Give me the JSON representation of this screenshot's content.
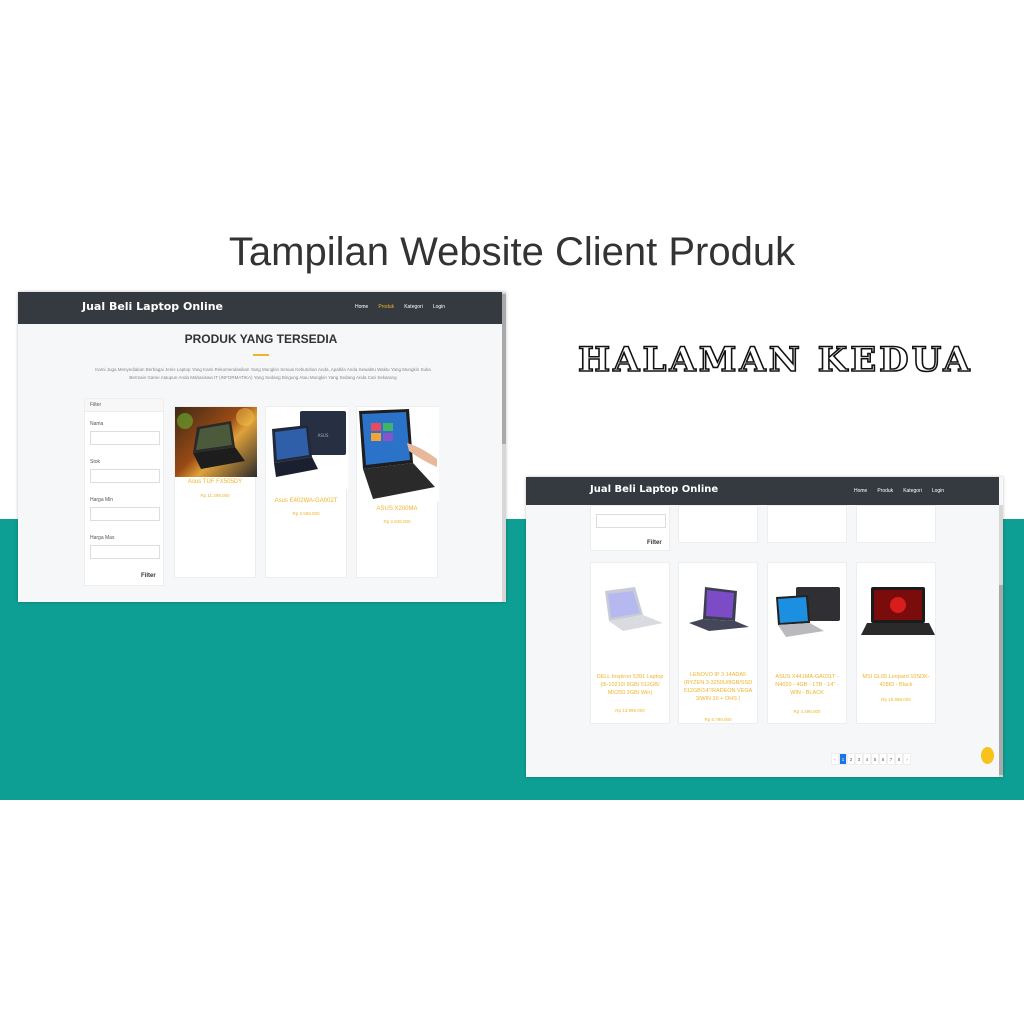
{
  "slide": {
    "title": "Tampilan Website Client Produk",
    "subtitle": "HALAMAN KEDUA",
    "colors": {
      "band": "#0e9f94",
      "navbar": "#343a40",
      "accent": "#f0b429"
    }
  },
  "shot1": {
    "brand": "Jual Beli Laptop Online",
    "nav": [
      "Home",
      "Produk",
      "Kategori",
      "Login"
    ],
    "heading": "PRODUK YANG TERSEDIA",
    "description": "Kami Juga Menyediakan Berbagai Jenis Laptop Yang Kami Rekomendasikan Yang Mungkin Sesuai Kebutuhan Anda, Apabila Anda Sewaktu Waktu Yang Mungkin Suka Bermain Game Ataupun Anda Mahasiswa IT (INFORMATIKA) Yang Sedang Bingung Atau Mungkin Yang Sedang Anda Cari Sekarang",
    "filter": {
      "title": "Filter",
      "fields": [
        "Nama",
        "Stok",
        "Harga Min",
        "Harga Max"
      ],
      "button": "Filter"
    },
    "products": [
      {
        "name": "Asus TUF FX505DY",
        "price": "Rp 11.299.000",
        "image": "gaming-laptop-image"
      },
      {
        "name": "Asus E402WA-GA002T",
        "price": "Rp 3.599.000",
        "image": "navy-laptop-image"
      },
      {
        "name": "ASUS X200MA",
        "price": "Rp 2.849.000",
        "image": "touchscreen-laptop-image"
      }
    ]
  },
  "shot2": {
    "brand": "Jual Beli Laptop Online",
    "nav": [
      "Home",
      "Produk",
      "Kategori",
      "Login"
    ],
    "filter_button": "Filter",
    "products": [
      {
        "name": "DELL Inspiron 5391 Laptop (i5-10210/ 8GB/ 512GB/ MX250 2GB/ Win)",
        "price": "Rp 13.999.000",
        "image": "silver-laptop-image"
      },
      {
        "name": "LENOVO IP 3 14ADA5 (RYZEN 3-3250U/8GB/SSD 512GB/14\"/RADEON VEGA 3/WIN 10 + OHS (",
        "price": "Rp 6.799.000",
        "image": "purple-laptop-image"
      },
      {
        "name": "ASUS X441MA-GA031T - N4020 - 4GB - 1TB - 14\" - WIN - BLACK",
        "price": "Rp 4.499.000",
        "image": "windows-laptop-image"
      },
      {
        "name": "MSI GL65 Leopard 10SDK-428ID - Black",
        "price": "Rp 15.999.000",
        "image": "msi-laptop-image"
      }
    ],
    "pagination": [
      "‹",
      "1",
      "2",
      "3",
      "4",
      "5",
      "6",
      "7",
      "8",
      "›"
    ],
    "active_page": "1"
  }
}
